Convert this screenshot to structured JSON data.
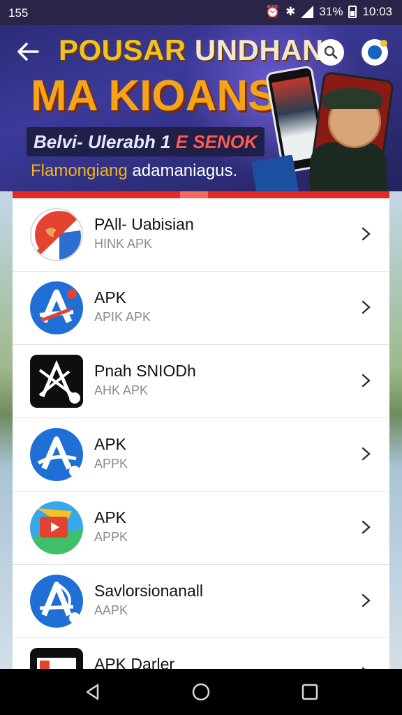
{
  "status_bar": {
    "left_text": "155",
    "alarm_icon": "alarm-icon",
    "bluetooth_icon": "bluetooth-icon",
    "battery_percent": "31%",
    "time": "10:03"
  },
  "banner": {
    "title_line1_a": "POUSAR",
    "title_line1_b": "UNDHAN",
    "title_line2": "MA KIOANSA",
    "tag1_a": "Belvi- Ulerabh 1",
    "tag1_b": "E SENOK",
    "tag2_a": "Flamongiang",
    "tag2_b": "adamaniagus.",
    "back_icon": "back-arrow-icon",
    "search_icon": "search-icon",
    "profile_icon": "profile-icon"
  },
  "list": {
    "items": [
      {
        "title": "PAll- Uabisian",
        "subtitle": "HINK APK",
        "icon": "flag-icon"
      },
      {
        "title": "APK",
        "subtitle": "APIK APK",
        "icon": "a-store-icon"
      },
      {
        "title": "Pnah SNIODh",
        "subtitle": "AHK APK",
        "icon": "x-app-icon"
      },
      {
        "title": "APK",
        "subtitle": "APPK",
        "icon": "a-store-icon"
      },
      {
        "title": "APK",
        "subtitle": "APPK",
        "icon": "video-player-icon"
      },
      {
        "title": "Savlorsionanall",
        "subtitle": "AAPK",
        "icon": "a-store-icon"
      },
      {
        "title": "APK Darler",
        "subtitle": "",
        "icon": "app-icon"
      }
    ]
  },
  "colors": {
    "accent_red": "#e32a24",
    "banner_bg": "#2d2b78",
    "icon_blue": "#1f6fd6"
  }
}
